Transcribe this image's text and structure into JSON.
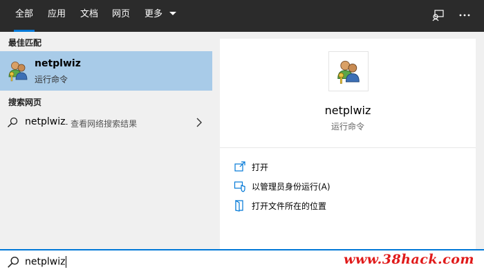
{
  "tabs": [
    {
      "label": "全部",
      "active": true
    },
    {
      "label": "应用"
    },
    {
      "label": "文档"
    },
    {
      "label": "网页"
    },
    {
      "label": "更多"
    }
  ],
  "top_icons": [
    "feedback-icon",
    "more-options-icon"
  ],
  "left": {
    "best_match_label": "最佳匹配",
    "best_match": {
      "title": "netplwiz",
      "subtitle": "运行命令",
      "icon": "users-keys-icon"
    },
    "web_label": "搜索网页",
    "web_result": {
      "term": "netplwiz",
      "suffix": "- 查看网络搜索结果",
      "icon": "search-icon",
      "chevron": "chevron-right-icon"
    }
  },
  "preview": {
    "app_name": "netplwiz",
    "app_type": "运行命令",
    "actions": [
      {
        "label": "打开",
        "icon": "open-icon"
      },
      {
        "label": "以管理员身份运行(A)",
        "icon": "shield-icon"
      },
      {
        "label": "打开文件所在的位置",
        "icon": "file-location-icon"
      }
    ]
  },
  "search": {
    "value": "netplwiz",
    "icon": "search-icon"
  },
  "watermark": "www.38hack.com",
  "colors": {
    "accent": "#0078d7",
    "selected": "#a8cbe8",
    "topbar": "#2b2b2b",
    "watermark": "#e01a1a"
  }
}
